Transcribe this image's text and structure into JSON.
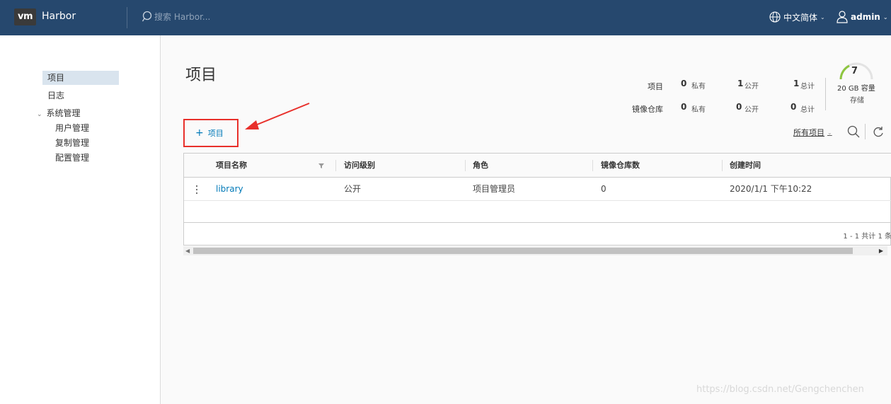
{
  "header": {
    "logo": "vm",
    "app_name": "Harbor",
    "search_placeholder": "搜索 Harbor...",
    "language": "中文简体",
    "user": "admin"
  },
  "sidebar": {
    "items": [
      {
        "label": "项目"
      },
      {
        "label": "日志"
      },
      {
        "label": "系统管理"
      }
    ],
    "sub_items": [
      {
        "label": "用户管理"
      },
      {
        "label": "复制管理"
      },
      {
        "label": "配置管理"
      }
    ]
  },
  "main": {
    "title": "项目",
    "stats": {
      "row1_label": "项目",
      "row2_label": "镜像仓库",
      "projects_private": "0",
      "projects_public": "1",
      "projects_total": "1",
      "repos_private": "0",
      "repos_public": "0",
      "repos_total": "0",
      "private_unit": "私有",
      "public_unit": "公开",
      "total_unit": "总计",
      "quota_count": "7",
      "capacity": "20 GB 容量",
      "storage": "存储"
    },
    "add_button": "项目",
    "filter_label": "所有项目",
    "table": {
      "headers": [
        "项目名称",
        "访问级别",
        "角色",
        "镜像仓库数",
        "创建时间"
      ],
      "rows": [
        [
          "library",
          "公开",
          "项目管理员",
          "0",
          "2020/1/1 下午10:22"
        ]
      ],
      "pagination": "1 - 1 共计 1 条"
    }
  },
  "watermark": "https://blog.csdn.net/Gengchenchen",
  "colors": {
    "header_bg": "#26486e",
    "link": "#0079b8",
    "highlight_red": "#e8302b",
    "gauge_green": "#8dc63f"
  }
}
